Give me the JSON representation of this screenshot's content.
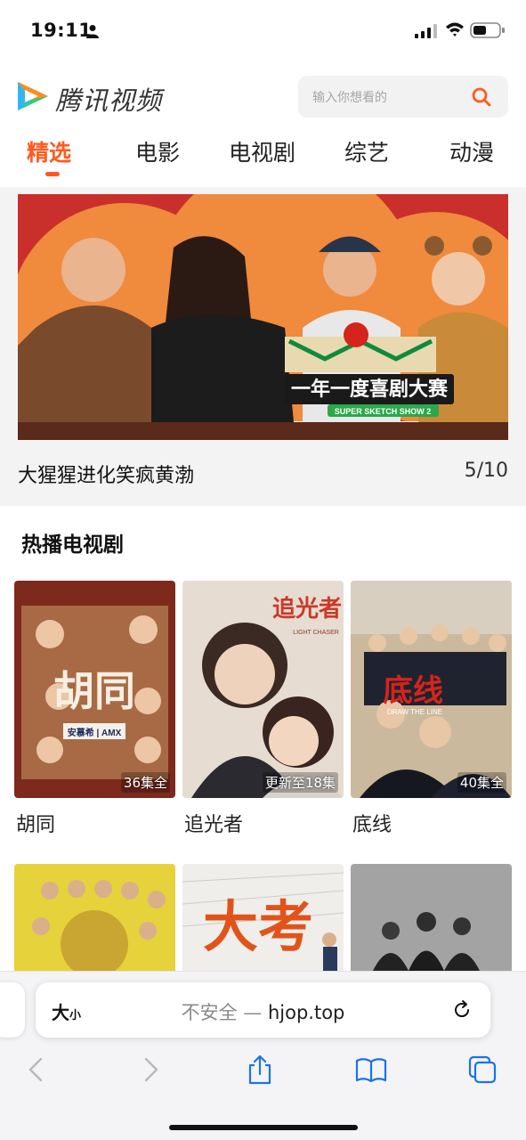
{
  "status_bar": {
    "time": "19:11"
  },
  "header": {
    "brand": "腾讯视频",
    "search_placeholder": "输入你想看的"
  },
  "tabs": [
    {
      "label": "精选",
      "active": true
    },
    {
      "label": "电影",
      "active": false
    },
    {
      "label": "电视剧",
      "active": false
    },
    {
      "label": "综艺",
      "active": false
    },
    {
      "label": "动漫",
      "active": false
    }
  ],
  "banner": {
    "caption": "大猩猩进化笑疯黄渤",
    "counter": "5/10",
    "poster_text": "一年一度喜剧大赛",
    "poster_subtext": "SUPER SKETCH SHOW 2"
  },
  "section": {
    "title": "热播电视剧"
  },
  "shows": [
    {
      "title": "胡同",
      "badge": "36集全",
      "poster_text": "胡同",
      "poster_sub": "安慕希 | AMX"
    },
    {
      "title": "追光者",
      "badge": "更新至18集",
      "poster_text": "追光者",
      "poster_sub": "LIGHT CHASER"
    },
    {
      "title": "底线",
      "badge": "40集全",
      "poster_text": "底线",
      "poster_sub": "DRAW THE LINE"
    }
  ],
  "shows_row2": [
    {
      "poster_text": ""
    },
    {
      "poster_text": "大考"
    },
    {
      "poster_text": ""
    }
  ],
  "safari": {
    "text_size_label": "大",
    "text_size_small": "小",
    "insecure_label": "不安全 —",
    "domain": "hjop.top"
  },
  "colors": {
    "accent": "#ff5a1f",
    "banner_red": "#c9302c",
    "banner_orange": "#f08a3c"
  }
}
